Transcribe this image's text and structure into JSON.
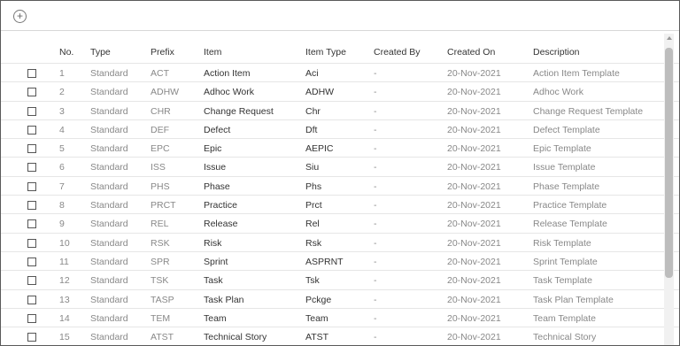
{
  "toolbar": {
    "add_icon": "plus-circle-icon",
    "add_glyph": "+"
  },
  "columns": {
    "no": "No.",
    "type": "Type",
    "prefix": "Prefix",
    "item": "Item",
    "item_type": "Item Type",
    "created_by": "Created By",
    "created_on": "Created On",
    "description": "Description"
  },
  "rows": [
    {
      "no": "1",
      "type": "Standard",
      "prefix": "ACT",
      "item": "Action Item",
      "item_type": "Aci",
      "created_by": "-",
      "created_on": "20-Nov-2021",
      "description": "Action Item Template"
    },
    {
      "no": "2",
      "type": "Standard",
      "prefix": "ADHW",
      "item": "Adhoc Work",
      "item_type": "ADHW",
      "created_by": "-",
      "created_on": "20-Nov-2021",
      "description": "Adhoc Work"
    },
    {
      "no": "3",
      "type": "Standard",
      "prefix": "CHR",
      "item": "Change Request",
      "item_type": "Chr",
      "created_by": "-",
      "created_on": "20-Nov-2021",
      "description": "Change Request Template"
    },
    {
      "no": "4",
      "type": "Standard",
      "prefix": "DEF",
      "item": "Defect",
      "item_type": "Dft",
      "created_by": "-",
      "created_on": "20-Nov-2021",
      "description": "Defect Template"
    },
    {
      "no": "5",
      "type": "Standard",
      "prefix": "EPC",
      "item": "Epic",
      "item_type": "AEPIC",
      "created_by": "-",
      "created_on": "20-Nov-2021",
      "description": "Epic Template"
    },
    {
      "no": "6",
      "type": "Standard",
      "prefix": "ISS",
      "item": "Issue",
      "item_type": "Siu",
      "created_by": "-",
      "created_on": "20-Nov-2021",
      "description": "Issue Template"
    },
    {
      "no": "7",
      "type": "Standard",
      "prefix": "PHS",
      "item": "Phase",
      "item_type": "Phs",
      "created_by": "-",
      "created_on": "20-Nov-2021",
      "description": "Phase Template"
    },
    {
      "no": "8",
      "type": "Standard",
      "prefix": "PRCT",
      "item": "Practice",
      "item_type": "Prct",
      "created_by": "-",
      "created_on": "20-Nov-2021",
      "description": "Practice Template"
    },
    {
      "no": "9",
      "type": "Standard",
      "prefix": "REL",
      "item": "Release",
      "item_type": "Rel",
      "created_by": "-",
      "created_on": "20-Nov-2021",
      "description": "Release Template"
    },
    {
      "no": "10",
      "type": "Standard",
      "prefix": "RSK",
      "item": "Risk",
      "item_type": "Rsk",
      "created_by": "-",
      "created_on": "20-Nov-2021",
      "description": "Risk Template"
    },
    {
      "no": "11",
      "type": "Standard",
      "prefix": "SPR",
      "item": "Sprint",
      "item_type": "ASPRNT",
      "created_by": "-",
      "created_on": "20-Nov-2021",
      "description": "Sprint Template"
    },
    {
      "no": "12",
      "type": "Standard",
      "prefix": "TSK",
      "item": "Task",
      "item_type": "Tsk",
      "created_by": "-",
      "created_on": "20-Nov-2021",
      "description": "Task Template"
    },
    {
      "no": "13",
      "type": "Standard",
      "prefix": "TASP",
      "item": "Task Plan",
      "item_type": "Pckge",
      "created_by": "-",
      "created_on": "20-Nov-2021",
      "description": "Task Plan Template"
    },
    {
      "no": "14",
      "type": "Standard",
      "prefix": "TEM",
      "item": "Team",
      "item_type": "Team",
      "created_by": "-",
      "created_on": "20-Nov-2021",
      "description": "Team Template"
    },
    {
      "no": "15",
      "type": "Standard",
      "prefix": "ATST",
      "item": "Technical Story",
      "item_type": "ATST",
      "created_by": "-",
      "created_on": "20-Nov-2021",
      "description": "Technical Story"
    }
  ]
}
